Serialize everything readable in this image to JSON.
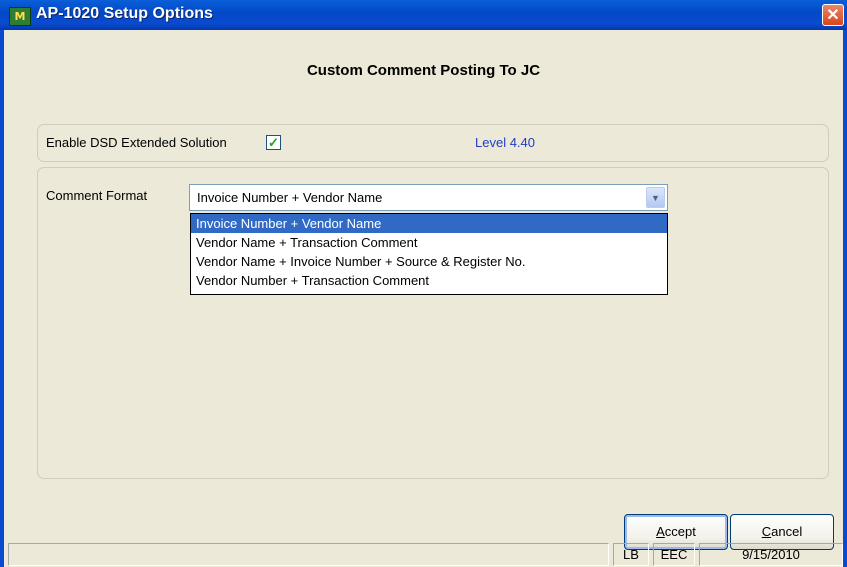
{
  "window": {
    "title": "AP-1020  Setup Options",
    "icon": "sage-mas90-app-icon",
    "icon_glyph": "M",
    "close_glyph": "✕"
  },
  "heading": "Custom Comment Posting To JC",
  "enable": {
    "label": "Enable DSD Extended Solution",
    "checked": true,
    "check_glyph": "✓"
  },
  "level": "Level  4.40",
  "comment_format": {
    "label": "Comment Format",
    "selected": "Invoice Number + Vendor Name",
    "options": [
      "Invoice Number + Vendor Name",
      "Vendor Name + Transaction Comment",
      "Vendor Name + Invoice Number + Source & Register No.",
      "Vendor Number + Transaction Comment"
    ]
  },
  "buttons": {
    "accept": {
      "prefix": "",
      "mnemonic": "A",
      "rest": "ccept"
    },
    "cancel": {
      "prefix": "",
      "mnemonic": "C",
      "rest": "ancel"
    }
  },
  "status": {
    "user": "LB",
    "company": "EEC",
    "date": "9/15/2010"
  },
  "colors": {
    "titlebar": "#0a4ad0",
    "selection": "#316ac5",
    "level_text": "#1f3fbf",
    "check": "#21a121"
  }
}
